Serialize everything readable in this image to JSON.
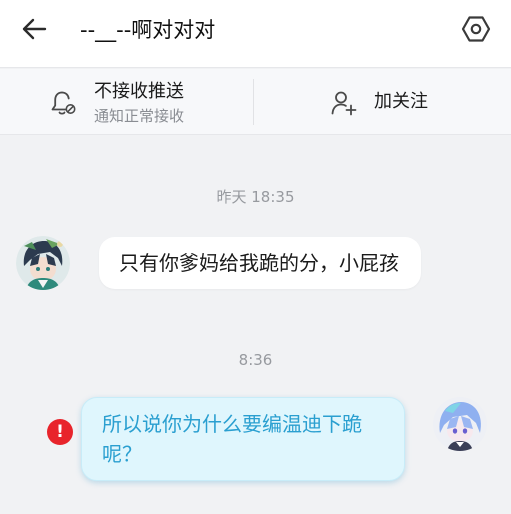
{
  "header": {
    "title": "--__--啊对对对",
    "back_icon": "arrow-left-icon",
    "settings_icon": "hexagon-settings-icon"
  },
  "action_bar": {
    "push": {
      "icon": "bell-mute-icon",
      "title": "不接收推送",
      "subtitle": "通知正常接收"
    },
    "follow": {
      "icon": "add-user-icon",
      "label": "加关注"
    }
  },
  "messages": [
    {
      "timestamp": "昨天 18:35",
      "direction": "incoming",
      "text": "只有你爹妈给我跪的分，小屁孩"
    },
    {
      "timestamp": "8:36",
      "direction": "outgoing",
      "text": "所以说你为什么要编温迪下跪呢？",
      "send_failed": true,
      "error_glyph": "!"
    }
  ],
  "colors": {
    "page_bg": "#f1f2f4",
    "outgoing_bubble": "#dff6fd",
    "outgoing_text": "#2a9fd0",
    "error": "#e8242b"
  }
}
